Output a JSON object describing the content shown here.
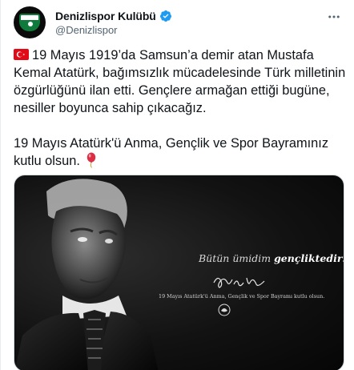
{
  "account": {
    "display_name": "Denizlispor Kulübü",
    "handle": "@Denizlispor",
    "verified": true,
    "avatar": "club-crest-avatar"
  },
  "tweet": {
    "paragraph_1": "19 Mayıs 1919’da Samsun’a demir atan Mustafa Kemal Atatürk, bağımsızlık mücadelesinde Türk milletinin özgürlüğünü ilan etti. Gençlere armağan ettiği bugüne, nesiller boyunca sahip çıkacağız.",
    "paragraph_2": "19 Mayıs Atatürk'ü Anma, Gençlik ve Spor Bayramınız kutlu olsun.",
    "leading_emoji": "turkey-flag-icon",
    "trailing_emoji": "balloon-icon"
  },
  "media": {
    "quote_normal": "Bütün ümidim ",
    "quote_bold": "gençliktedir!",
    "caption": "19 Mayıs Atatürk'ü Anma, Gençlik ve Spor Bayramı kutlu olsun."
  },
  "colors": {
    "verified_blue": "#1d9bf0",
    "flag_red": "#e30a17",
    "club_green": "#0e7a3b",
    "text_secondary": "#536471"
  }
}
